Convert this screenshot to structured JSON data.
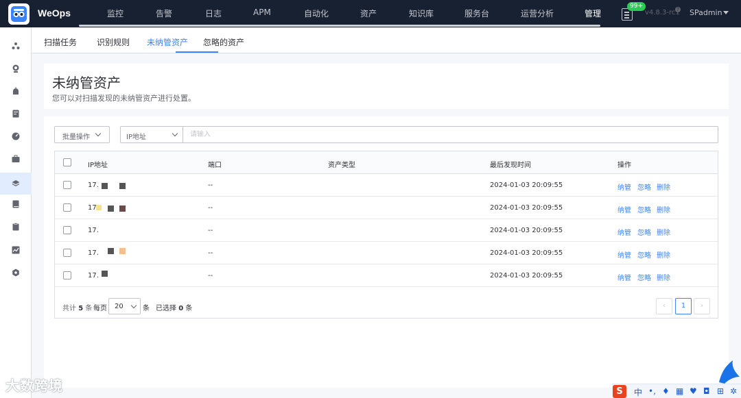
{
  "app": {
    "brand": "WeOps",
    "nav": [
      "监控",
      "告警",
      "日志",
      "APM",
      "自动化",
      "资产",
      "知识库",
      "服务台",
      "运营分析",
      "管理"
    ],
    "active_nav": "管理",
    "notice_badge": "99+",
    "version": "v4.8.3-rc1",
    "user": "SPadmin"
  },
  "sidebar": {
    "icons": [
      "topology-icon",
      "camera-icon",
      "alarm-icon",
      "report-icon",
      "dashboard-icon",
      "toolbox-icon",
      "layers-icon",
      "book-icon",
      "clipboard-icon",
      "chart-icon",
      "settings-icon"
    ],
    "active_index": 6
  },
  "tabs": [
    "扫描任务",
    "识别规则",
    "未纳管资产",
    "忽略的资产"
  ],
  "active_tab": "未纳管资产",
  "header": {
    "title": "未纳管资产",
    "description": "您可以对扫描发现的未纳管资产进行处置。"
  },
  "toolbar": {
    "bulk_label": "批量操作",
    "field_label": "IP地址",
    "search_placeholder": "请输入"
  },
  "table": {
    "columns": [
      "IP地址",
      "端口",
      "资产类型",
      "最后发现时间",
      "操作"
    ],
    "rows": [
      {
        "ip": "17.",
        "port": "--",
        "type": "",
        "last_seen": "2024-01-03 20:09:55"
      },
      {
        "ip": "172",
        "port": "--",
        "type": "",
        "last_seen": "2024-01-03 20:09:55"
      },
      {
        "ip": "17.",
        "port": "--",
        "type": "",
        "last_seen": "2024-01-03 20:09:55"
      },
      {
        "ip": "17.",
        "port": "--",
        "type": "",
        "last_seen": "2024-01-03 20:09:55"
      },
      {
        "ip": "17.",
        "port": "--",
        "type": "",
        "last_seen": "2024-01-03 20:09:55"
      }
    ],
    "actions": [
      "纳管",
      "忽略",
      "删除"
    ]
  },
  "pager": {
    "total_prefix": "共计",
    "total": "5",
    "total_unit": "条",
    "per_page_label": "每页",
    "page_size": "20",
    "page_size_unit": "条",
    "selected_prefix": "已选择",
    "selected": "0",
    "selected_unit": "条",
    "current_page": "1",
    "prev": "‹",
    "next": "›"
  },
  "watermark": "大数跨境",
  "ime": {
    "logo": "S",
    "mode": "中"
  },
  "colors": {
    "accent": "#3a84ff",
    "topbar": "#182132",
    "badge": "#2dcb56"
  }
}
